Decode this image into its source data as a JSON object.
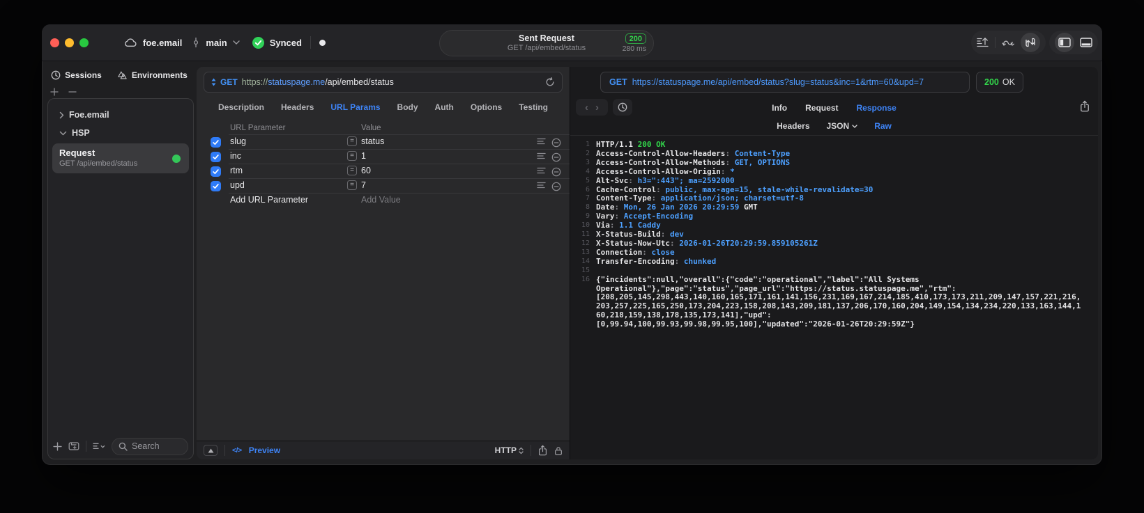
{
  "titlebar": {
    "project": "foe.email",
    "branch": "main",
    "sync_status": "Synced",
    "center": {
      "title": "Sent Request",
      "subtitle": "GET /api/embed/status",
      "status_code": "200",
      "duration": "280 ms"
    }
  },
  "sidebar": {
    "tabs": [
      {
        "label": "Sessions",
        "icon": "clock-icon"
      },
      {
        "label": "Environments",
        "icon": "environments-icon"
      }
    ],
    "tree": [
      {
        "label": "Foe.email",
        "state": "collapsed"
      },
      {
        "label": "HSP",
        "state": "expanded"
      }
    ],
    "request_item": {
      "title": "Request",
      "subtitle": "GET /api/embed/status"
    },
    "search_placeholder": "Search"
  },
  "request_panel": {
    "method": "GET",
    "url_scheme": "https://",
    "url_host": "statuspage.me",
    "url_path": "/api/embed/status",
    "tabs": [
      "Description",
      "Headers",
      "URL Params",
      "Body",
      "Auth",
      "Options",
      "Testing"
    ],
    "active_tab": "URL Params",
    "table": {
      "columns": [
        "URL Parameter",
        "Value"
      ],
      "rows": [
        {
          "name": "slug",
          "value": "status",
          "checked": true
        },
        {
          "name": "inc",
          "value": "1",
          "checked": true
        },
        {
          "name": "rtm",
          "value": "60",
          "checked": true
        },
        {
          "name": "upd",
          "value": "7",
          "checked": true
        }
      ],
      "add_name_placeholder": "Add URL Parameter",
      "add_value_placeholder": "Add Value"
    },
    "footer": {
      "code_glyph": "</>",
      "preview_label": "Preview",
      "mode_label": "HTTP"
    }
  },
  "response_panel": {
    "method": "GET",
    "url": "https://statuspage.me/api/embed/status?slug=status&inc=1&rtm=60&upd=7",
    "status": {
      "code": "200",
      "text": "OK"
    },
    "tabs": [
      "Info",
      "Request",
      "Response"
    ],
    "active_tab": "Response",
    "view_tabs": [
      "Headers",
      "JSON",
      "Raw"
    ],
    "active_view": "Raw",
    "code_lines": [
      {
        "n": "1",
        "s": [
          [
            "HTTP/1.1 ",
            "k"
          ],
          [
            "200 OK",
            "g"
          ]
        ]
      },
      {
        "n": "2",
        "s": [
          [
            "Access-Control-Allow-Headers",
            "k"
          ],
          [
            ": ",
            "p"
          ],
          [
            "Content-Type",
            "v"
          ]
        ]
      },
      {
        "n": "3",
        "s": [
          [
            "Access-Control-Allow-Methods",
            "k"
          ],
          [
            ": ",
            "p"
          ],
          [
            "GET, OPTIONS",
            "v"
          ]
        ]
      },
      {
        "n": "4",
        "s": [
          [
            "Access-Control-Allow-Origin",
            "k"
          ],
          [
            ": ",
            "p"
          ],
          [
            "*",
            "v"
          ]
        ]
      },
      {
        "n": "5",
        "s": [
          [
            "Alt-Svc",
            "k"
          ],
          [
            ": ",
            "p"
          ],
          [
            "h3=\":443\"; ma=2592000",
            "v"
          ]
        ]
      },
      {
        "n": "6",
        "s": [
          [
            "Cache-Control",
            "k"
          ],
          [
            ": ",
            "p"
          ],
          [
            "public, max-age=15, stale-while-revalidate=30",
            "v"
          ]
        ]
      },
      {
        "n": "7",
        "s": [
          [
            "Content-Type",
            "k"
          ],
          [
            ": ",
            "p"
          ],
          [
            "application/json; charset=utf-8",
            "v"
          ]
        ]
      },
      {
        "n": "8",
        "s": [
          [
            "Date",
            "k"
          ],
          [
            ": ",
            "p"
          ],
          [
            "Mon, 26 Jan 2026 20:29:59 ",
            "v"
          ],
          [
            "GMT",
            "k"
          ]
        ]
      },
      {
        "n": "9",
        "s": [
          [
            "Vary",
            "k"
          ],
          [
            ": ",
            "p"
          ],
          [
            "Accept-Encoding",
            "v"
          ]
        ]
      },
      {
        "n": "10",
        "s": [
          [
            "Via",
            "k"
          ],
          [
            ": ",
            "p"
          ],
          [
            "1.1 Caddy",
            "v"
          ]
        ]
      },
      {
        "n": "11",
        "s": [
          [
            "X-Status-Build",
            "k"
          ],
          [
            ": ",
            "p"
          ],
          [
            "dev",
            "v"
          ]
        ]
      },
      {
        "n": "12",
        "s": [
          [
            "X-Status-Now-Utc",
            "k"
          ],
          [
            ": ",
            "p"
          ],
          [
            "2026-01-26T20:29:59.859105261Z",
            "v"
          ]
        ]
      },
      {
        "n": "13",
        "s": [
          [
            "Connection",
            "k"
          ],
          [
            ": ",
            "p"
          ],
          [
            "close",
            "v"
          ]
        ]
      },
      {
        "n": "14",
        "s": [
          [
            "Transfer-Encoding",
            "k"
          ],
          [
            ": ",
            "p"
          ],
          [
            "chunked",
            "v"
          ]
        ]
      },
      {
        "n": "15",
        "s": []
      },
      {
        "n": "16",
        "s": [
          [
            "{\"incidents\":null,\"overall\":{\"code\":\"operational\",\"label\":\"All Systems",
            "k"
          ]
        ]
      },
      {
        "n": "",
        "s": [
          [
            "Operational\"},\"page\":\"status\",\"page_url\":\"https://status.statuspage.me\",\"rtm\":",
            "k"
          ]
        ]
      },
      {
        "n": "",
        "s": [
          [
            "[208,205,145,298,443,140,160,165,171,161,141,156,231,169,167,214,185,410,173,173,211,209,147,157,221,216,",
            "k"
          ]
        ]
      },
      {
        "n": "",
        "s": [
          [
            "203,257,225,165,250,173,204,223,158,208,143,209,181,137,206,170,160,204,149,154,134,234,220,133,163,144,1",
            "k"
          ]
        ]
      },
      {
        "n": "",
        "s": [
          [
            "60,218,159,138,178,135,173,141],\"upd\":",
            "k"
          ]
        ]
      },
      {
        "n": "",
        "s": [
          [
            "[0,99.94,100,99.93,99.98,99.95,100],\"updated\":\"2026-01-26T20:29:59Z\"}",
            "k"
          ]
        ]
      }
    ]
  },
  "colors": {
    "accent_blue": "#3e84f7",
    "code_value_blue": "#4da0ff",
    "status_green": "#32d74b",
    "checkbox_blue": "#2f7bf7",
    "traffic_red": "#ff5f57",
    "traffic_yellow": "#febc2e",
    "traffic_green": "#28c840"
  }
}
